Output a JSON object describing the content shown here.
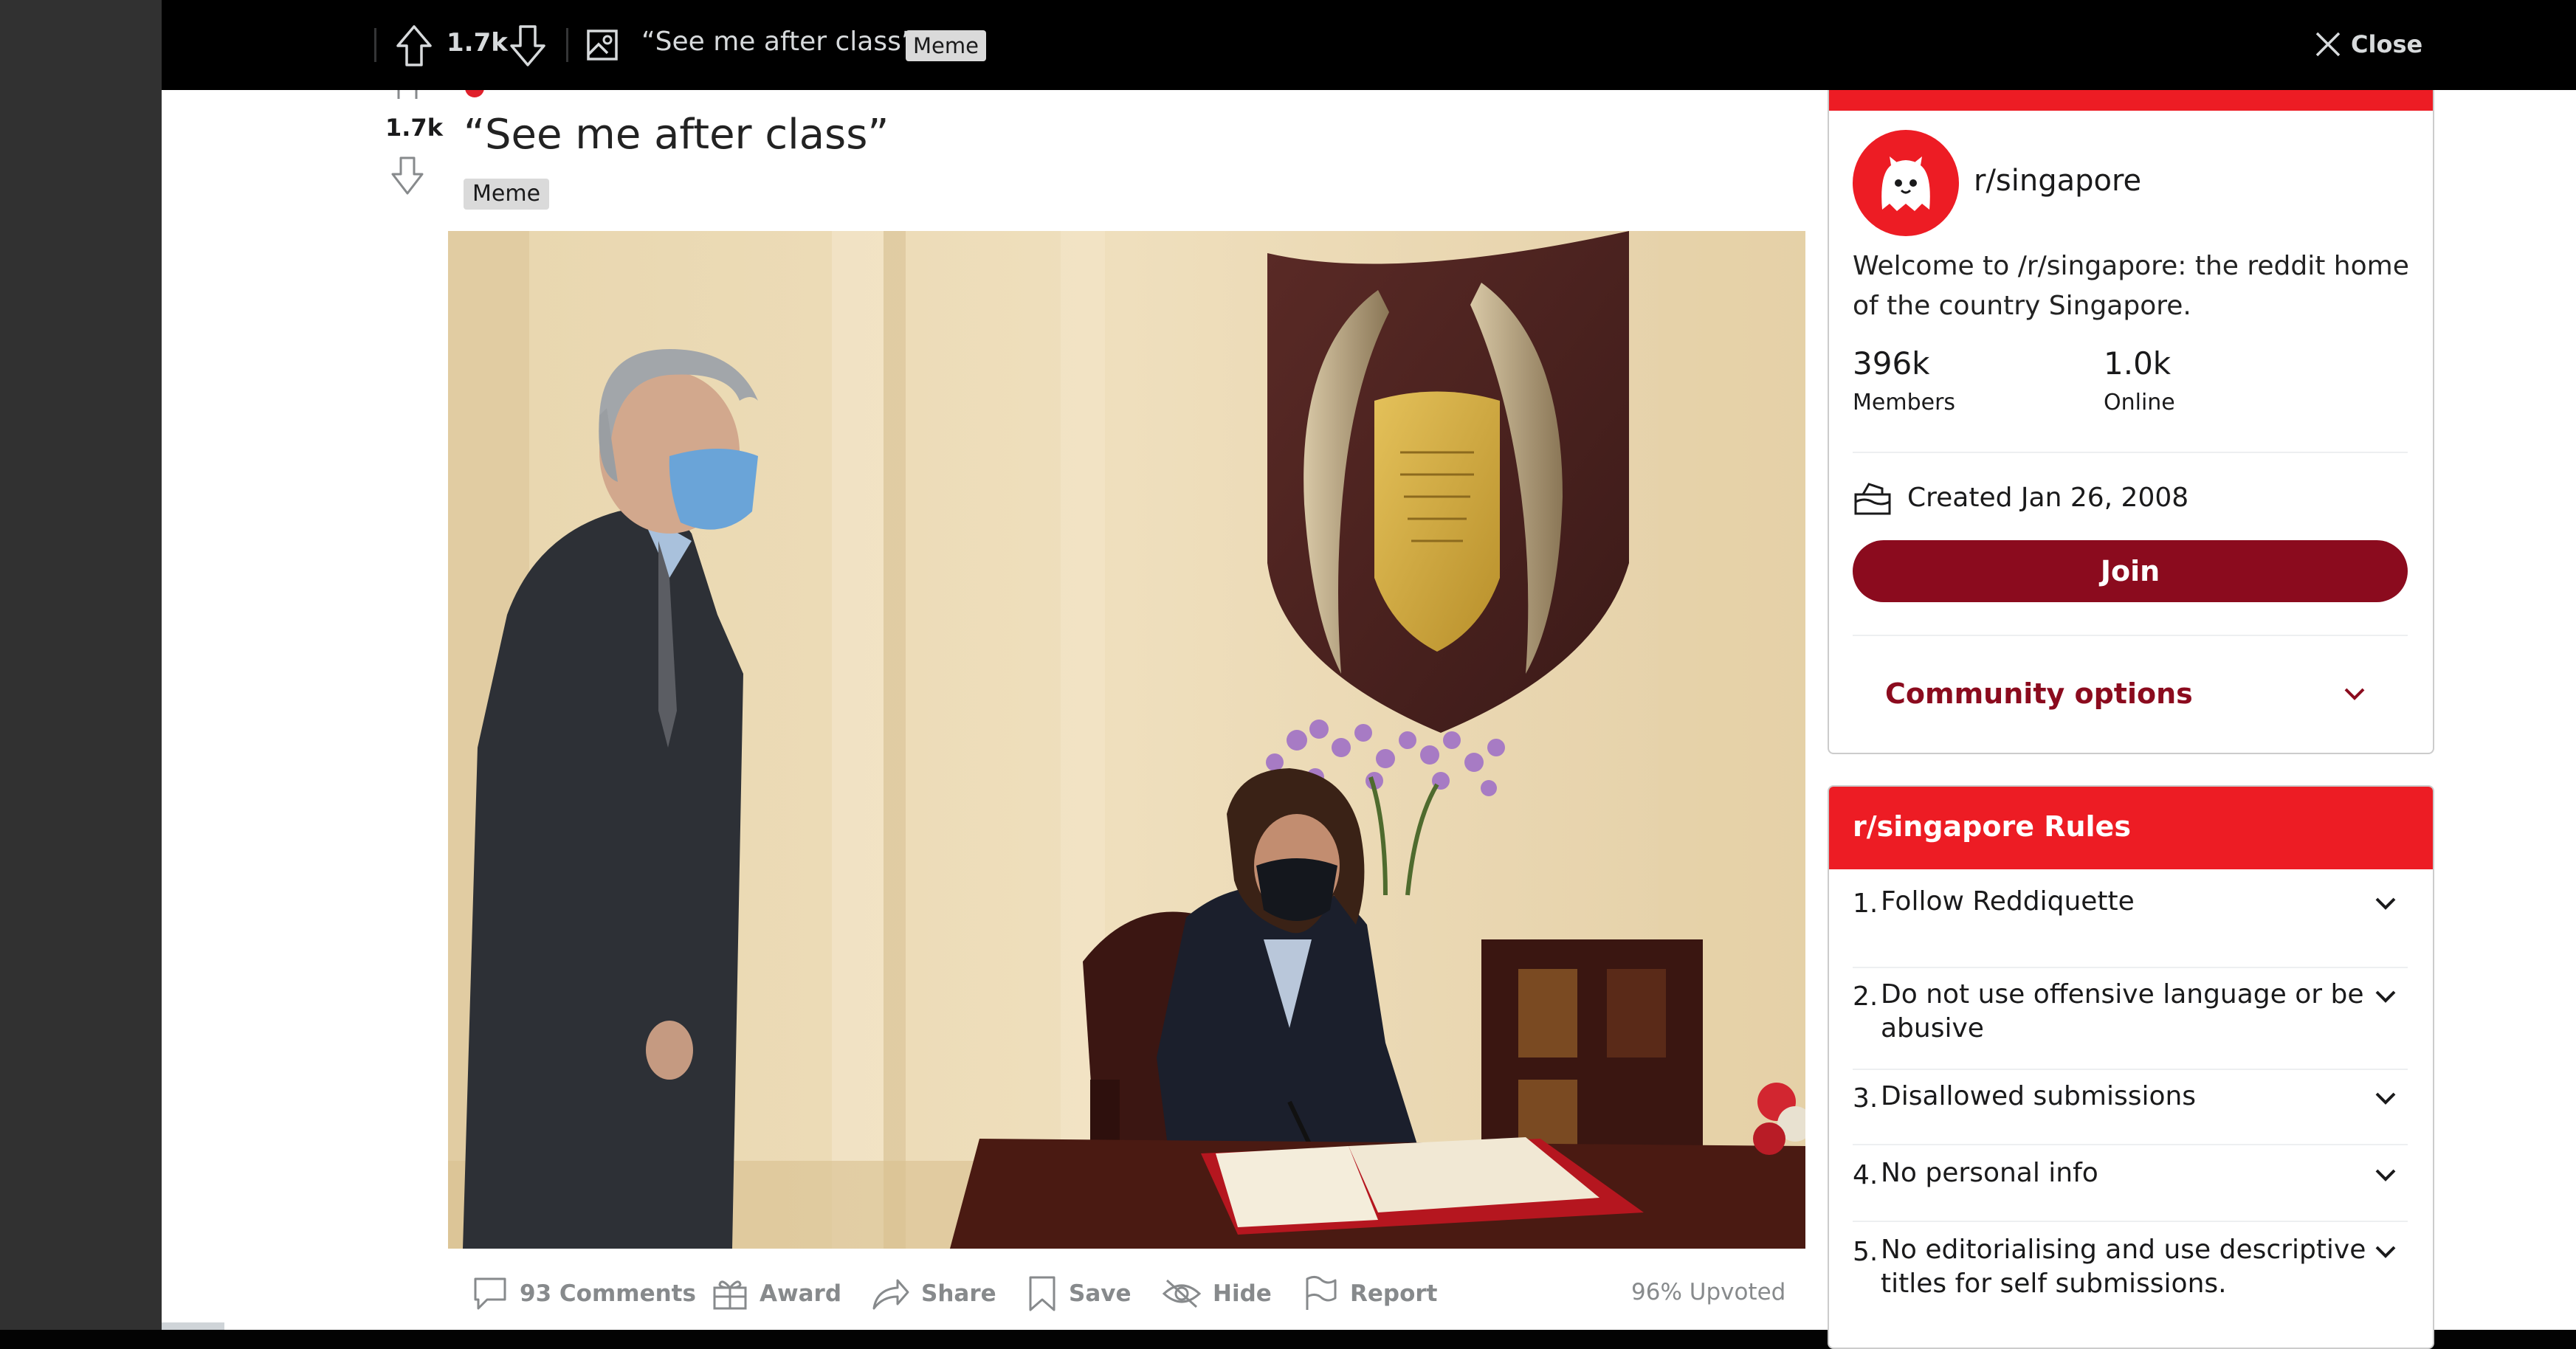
{
  "topbar": {
    "vote_count": "1.7k",
    "title": "“See me after class”",
    "flair": "Meme",
    "close_label": "Close"
  },
  "post": {
    "vote_count": "1.7k",
    "title": "“See me after class”",
    "flair": "Meme",
    "actions": {
      "comments": "93 Comments",
      "award": "Award",
      "share": "Share",
      "save": "Save",
      "hide": "Hide",
      "report": "Report"
    },
    "upvoted": "96% Upvoted"
  },
  "community": {
    "name": "r/singapore",
    "description_line1": "Welcome to /r/singapore: the reddit home",
    "description_line2": "of the country Singapore.",
    "members_value": "396k",
    "members_label": "Members",
    "online_value": "1.0k",
    "online_label": "Online",
    "created": "Created Jan 26, 2008",
    "join_label": "Join",
    "options_label": "Community options"
  },
  "rules": {
    "header": "r/singapore Rules",
    "items": [
      {
        "num": "1.",
        "line1": "Follow Reddiquette",
        "line2": ""
      },
      {
        "num": "2.",
        "line1": "Do not use offensive language or be",
        "line2": "abusive"
      },
      {
        "num": "3.",
        "line1": "Disallowed submissions",
        "line2": ""
      },
      {
        "num": "4.",
        "line1": "No personal info",
        "line2": ""
      },
      {
        "num": "5.",
        "line1": "No editorialising and use descriptive",
        "line2": "titles for self submissions."
      }
    ]
  },
  "colors": {
    "accent_red": "#ed1c24",
    "join_button": "#8b0b1e",
    "community_options": "#8b0b1e",
    "topbar_bg": "#000000"
  }
}
